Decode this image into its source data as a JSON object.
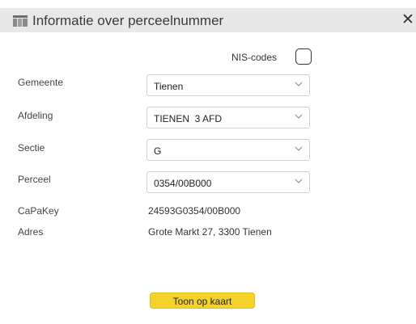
{
  "dialog": {
    "title": "Informatie over perceelnummer",
    "close_symbol": "✕",
    "title_icon": "table-icon"
  },
  "nis": {
    "label": "NIS-codes",
    "checked": false
  },
  "fields": {
    "gemeente": {
      "label": "Gemeente",
      "value": "Tienen"
    },
    "afdeling": {
      "label": "Afdeling",
      "value": "TIENEN  3 AFD"
    },
    "sectie": {
      "label": "Sectie",
      "value": "G"
    },
    "perceel": {
      "label": "Perceel",
      "value": "0354/00B000"
    }
  },
  "info": {
    "capakey": {
      "label": "CaPaKey",
      "value": "24593G0354/00B000"
    },
    "adres": {
      "label": "Adres",
      "value": "Grote Markt 27, 3300 Tienen"
    }
  },
  "actions": {
    "show_on_map": "Toon op kaart"
  },
  "colors": {
    "titlebar": "#e8e8e8",
    "button": "#f5d22a"
  }
}
